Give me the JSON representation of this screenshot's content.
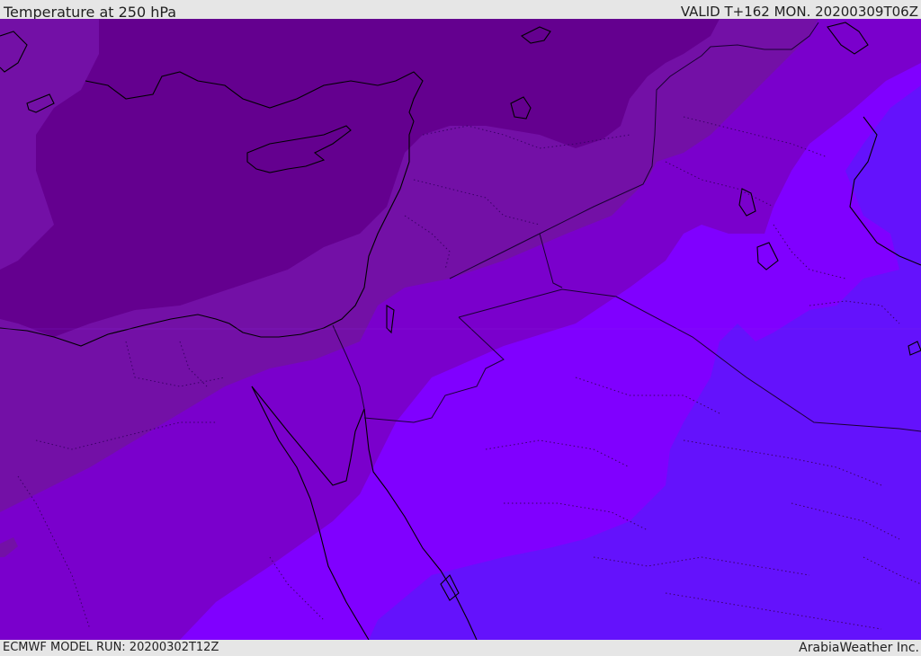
{
  "header": {
    "title": "Temperature at 250 hPa",
    "valid": "VALID T+162 MON. 20200309T06Z"
  },
  "footer": {
    "model_run": "ECMWF MODEL RUN: 20200302T12Z",
    "brand": "ArabiaWeather Inc."
  },
  "map": {
    "colors": {
      "coldest": "#64008f",
      "cold": "#7310a6",
      "mid": "#7a00cc",
      "warm": "#8000ff",
      "warmest": "#6412fc",
      "coast": "#000000",
      "border": "#1a0033"
    }
  }
}
